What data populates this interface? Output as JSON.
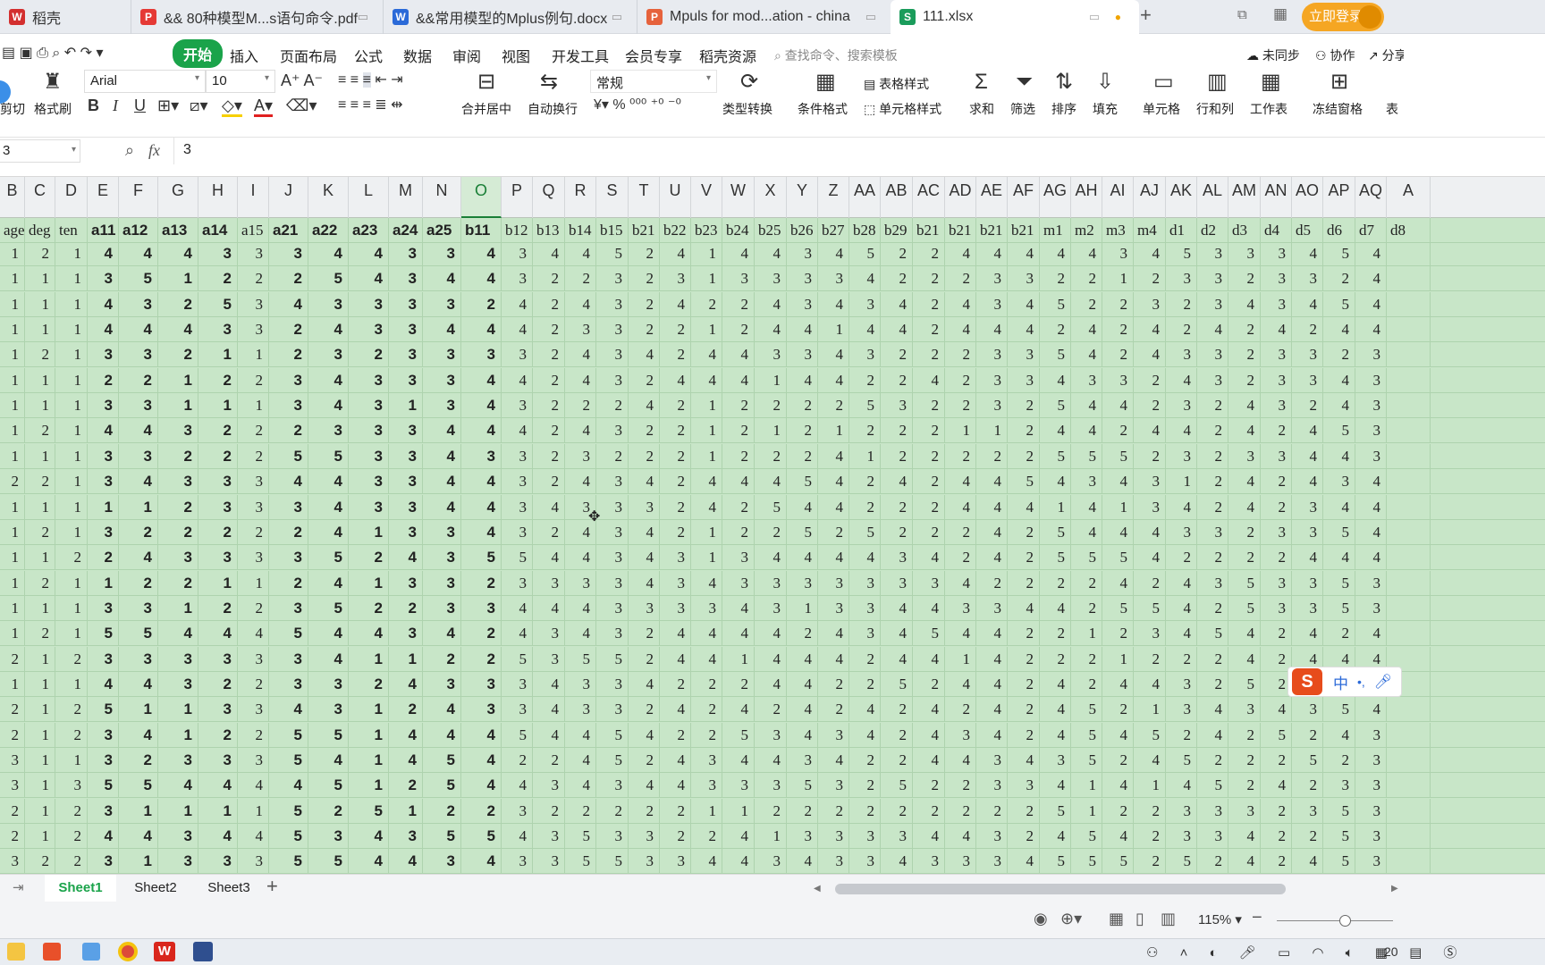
{
  "tabs": [
    {
      "label": "稻壳",
      "icon": "daoke-icon",
      "color": "#d32f2f"
    },
    {
      "label": "&& 80种模型M...s语句命令.pdf",
      "icon": "pdf-icon",
      "color": "#e53935"
    },
    {
      "label": "&&常用模型的Mplus例句.docx",
      "icon": "word-icon",
      "color": "#2b6ad8"
    },
    {
      "label": "Mpuls for mod...ation - china",
      "icon": "ppt-icon",
      "color": "#e6623c"
    },
    {
      "label": "111.xlsx",
      "icon": "excel-icon",
      "color": "#1a9c5b"
    }
  ],
  "login_label": "立即登录",
  "menu": {
    "items": [
      "开始",
      "插入",
      "页面布局",
      "公式",
      "数据",
      "审阅",
      "视图",
      "开发工具",
      "会员专享",
      "稻壳资源"
    ],
    "search_placeholder": "查找命令、搜索模板",
    "sync": "未同步",
    "collab": "协作",
    "share": "分享"
  },
  "ribbon": {
    "brush": "格式刷",
    "cut": "剪切",
    "font_name": "Arial",
    "font_size": "10",
    "merge": "合并居中",
    "wrap": "自动换行",
    "number_format": "常规",
    "convert": "类型转换",
    "cond_format": "条件格式",
    "table_style": "表格样式",
    "cell_style": "单元格样式",
    "sum": "求和",
    "filter": "筛选",
    "sort": "排序",
    "fill": "填充",
    "cell": "单元格",
    "rowcol": "行和列",
    "sheet": "工作表",
    "freeze": "冻结窗格",
    "more": "表"
  },
  "formula": {
    "name_box": "3",
    "fx": "fx",
    "value": "3"
  },
  "columns": [
    "B",
    "C",
    "D",
    "E",
    "F",
    "G",
    "H",
    "I",
    "J",
    "K",
    "L",
    "M",
    "N",
    "O",
    "P",
    "Q",
    "R",
    "S",
    "T",
    "U",
    "V",
    "W",
    "X",
    "Y",
    "Z",
    "AA",
    "AB",
    "AC",
    "AD",
    "AE",
    "AF",
    "AG",
    "AH",
    "AI",
    "AJ",
    "AK",
    "AL",
    "AM",
    "AN",
    "AO",
    "AP",
    "AQ",
    "A"
  ],
  "selected_column": "O",
  "header_row": [
    "age",
    "deg",
    "ten",
    "a11",
    "a12",
    "a13",
    "a14",
    "a15",
    "a21",
    "a22",
    "a23",
    "a24",
    "a25",
    "b11",
    "b12",
    "b13",
    "b14",
    "b15",
    "b21",
    "b22",
    "b23",
    "b24",
    "b25",
    "b26",
    "b27",
    "b28",
    "b29",
    "b21",
    "b21",
    "b21",
    "b21",
    "m1",
    "m2",
    "m3",
    "m4",
    "d1",
    "d2",
    "d3",
    "d4",
    "d5",
    "d6",
    "d7",
    "d8"
  ],
  "bold_columns": [
    "a11",
    "a12",
    "a13",
    "a14",
    "a21",
    "a22",
    "a23",
    "a24",
    "a25",
    "b11"
  ],
  "rows": [
    "1 2 1 4 4 4 3 3 3 4 4 3 3 4 3 4 4 5 2 4 1 4 4 3 4 5 2 2 4 4 4 4 4 3 4 5 3 3 3 4 5 4 .",
    "1 1 1 3 5 1 2 2 2 5 4 3 4 4 3 2 2 3 2 3 1 3 3 3 3 4 2 2 2 3 3 2 2 1 2 3 3 2 3 3 2 4 .",
    "1 1 1 4 3 2 5 3 4 3 3 3 3 2 4 2 4 3 2 4 2 2 4 3 4 3 4 2 4 3 4 5 2 2 3 2 3 4 3 4 5 4 .",
    "1 1 1 4 4 4 3 3 2 4 3 3 4 4 4 2 3 3 2 2 1 2 4 4 1 4 4 2 4 4 4 2 4 2 4 2 4 2 4 2 4 4 .",
    "1 2 1 3 3 2 1 1 2 3 2 3 3 3 3 2 4 3 4 2 4 4 3 3 4 3 2 2 2 3 3 5 4 2 4 3 3 2 3 3 2 3 .",
    "1 1 1 2 2 1 2 2 3 4 3 3 3 4 4 2 4 3 2 4 4 4 1 4 4 2 2 4 2 3 3 4 3 3 2 4 3 2 3 3 4 3 .",
    "1 1 1 3 3 1 1 1 3 4 3 1 3 4 3 2 2 2 4 2 1 2 2 2 2 5 3 2 2 3 2 5 4 4 2 3 2 4 3 2 4 3 .",
    "1 2 1 4 4 3 2 2 2 3 3 3 4 4 4 2 4 3 2 2 1 2 1 2 1 2 2 2 1 1 2 4 4 2 4 4 2 4 2 4 5 3 .",
    "1 1 1 3 3 2 2 2 5 5 3 3 4 3 3 2 3 2 2 2 1 2 2 2 4 1 2 2 2 2 2 5 5 5 2 3 2 3 3 4 4 3 .",
    "2 2 1 3 4 3 3 3 4 4 3 3 4 4 3 2 4 3 4 2 4 4 4 5 4 2 4 2 4 4 5 4 3 4 3 1 2 4 2 4 3 4 .",
    "1 1 1 1 1 2 3 3 3 4 3 3 4 4 3 4 3 3 3 2 4 2 5 4 4 2 2 2 4 4 4 1 4 1 3 4 2 4 2 3 4 4 .",
    "1 2 1 3 2 2 2 2 2 4 1 3 3 4 3 2 4 3 4 2 1 2 2 5 2 5 2 2 2 4 2 5 4 4 4 3 3 2 3 3 5 4 .",
    "1 1 2 2 4 3 3 3 3 5 2 4 3 5 5 4 4 3 4 3 1 3 4 4 4 4 3 4 2 4 2 5 5 5 4 2 2 2 2 4 4 4 .",
    "1 2 1 1 2 2 1 1 2 4 1 3 3 2 3 3 3 3 4 3 4 3 3 3 3 3 3 3 4 2 2 2 2 4 2 4 3 5 3 3 5 3 .",
    "1 1 1 3 3 1 2 2 3 5 2 2 3 3 4 4 4 3 3 3 3 4 3 1 3 3 4 4 3 3 4 4 2 5 5 4 2 5 3 3 5 3 .",
    "1 2 1 5 5 4 4 4 5 4 4 3 4 2 4 3 4 3 2 4 4 4 4 2 4 3 4 5 4 4 2 2 1 2 3 4 5 4 2 4 2 4 .",
    "2 1 2 3 3 3 3 3 3 4 1 1 2 2 5 3 5 5 2 4 4 1 4 4 4 2 4 4 1 4 2 2 2 1 2 2 2 4 2 4 4 4 .",
    "1 1 1 4 4 3 2 2 3 3 2 4 3 3 3 4 3 3 4 2 2 2 4 4 2 2 5 2 4 4 2 4 2 4 4 3 2 5 2 5 4 3 .",
    "2 1 2 5 1 1 3 3 4 3 1 2 4 3 3 4 3 3 2 4 2 4 2 4 2 4 2 4 2 4 2 4 5 2 1 3 4 3 4 3 5 4 .",
    "2 1 2 3 4 1 2 2 5 5 1 4 4 4 5 4 4 5 4 2 2 5 3 4 3 4 2 4 3 4 2 4 5 4 5 2 4 2 5 2 4 3 .",
    "3 1 1 3 2 3 3 3 5 4 1 4 5 4 2 2 4 5 2 4 3 4 4 3 4 2 2 4 4 3 4 3 5 2 4 5 2 2 2 5 2 3 .",
    "3 1 3 5 5 4 4 4 4 5 1 2 5 4 4 3 4 3 4 4 3 3 3 5 3 2 5 2 2 3 3 4 1 4 1 4 5 2 4 2 3 3 .",
    "2 1 2 3 1 1 1 1 5 2 5 1 2 2 3 2 2 2 2 2 1 1 2 2 2 2 2 2 2 2 2 5 1 2 2 3 3 3 2 3 5 3 .",
    "2 1 2 4 4 3 4 4 5 3 4 3 5 5 4 3 5 3 3 2 2 4 1 3 3 3 3 4 4 3 2 4 5 4 2 3 3 4 2 2 5 3 .",
    "3 2 2 3 1 3 3 3 5 5 4 4 3 4 3 3 5 5 3 3 4 4 3 4 3 3 4 3 3 3 4 5 5 5 2 5 2 4 2 4 5 3 ."
  ],
  "sheets": [
    "Sheet1",
    "Sheet2",
    "Sheet3"
  ],
  "active_sheet": "Sheet1",
  "status": {
    "zoom": "115%"
  },
  "taskbar": {
    "time_partial": "20"
  },
  "ime": {
    "label": "中",
    "logo": "S"
  }
}
